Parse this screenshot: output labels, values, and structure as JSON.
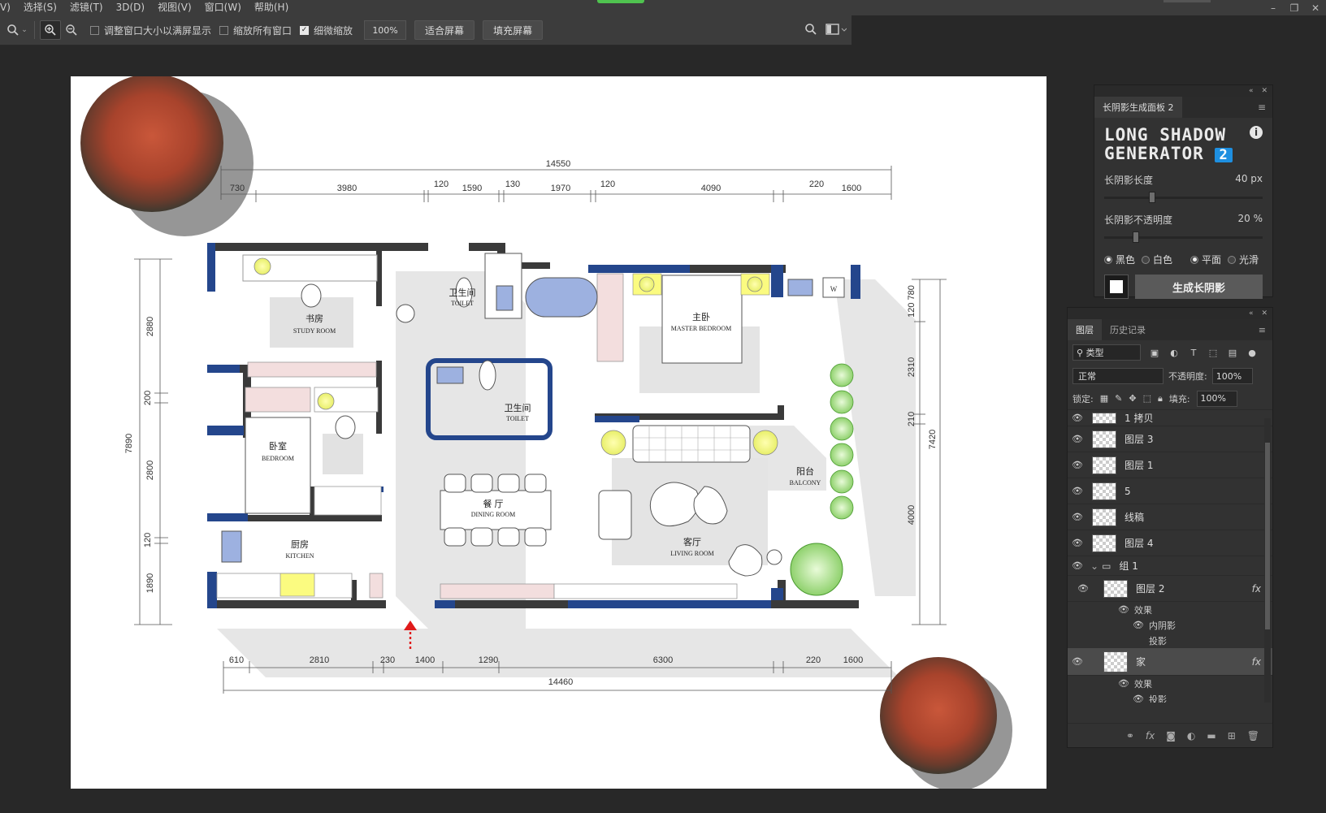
{
  "menu": [
    "V)",
    "选择(S)",
    "滤镜(T)",
    "3D(D)",
    "视图(V)",
    "窗口(W)",
    "帮助(H)"
  ],
  "options": {
    "resize_windows": "调整窗口大小以满屏显示",
    "zoom_all": "缩放所有窗口",
    "scrubby_zoom": "细微缩放",
    "zoom_pct": "100%",
    "fit_screen": "适合屏幕",
    "fill_screen": "填充屏幕"
  },
  "long_shadow": {
    "tab": "长阴影生成面板 2",
    "title_line1": "LONG SHADOW",
    "title_line2": "GENERATOR",
    "version": "2",
    "info": "i",
    "length_label": "长阴影长度",
    "length_value": "40 px",
    "length_level": 0.3,
    "opacity_label": "长阴影不透明度",
    "opacity_value": "20 %",
    "opacity_level": 0.2,
    "black": "黑色",
    "white": "白色",
    "flat": "平面",
    "smooth": "光滑",
    "generate": "生成长阴影"
  },
  "layers_panel": {
    "tab_layers": "图层",
    "tab_history": "历史记录",
    "filter_kind": "类型",
    "blend_mode": "正常",
    "opacity_label": "不透明度:",
    "opacity": "100%",
    "lock_label": "锁定:",
    "fill_label": "填充:",
    "fill": "100%",
    "layers": [
      "1 拷贝",
      "图层 3",
      "图层 1",
      "5",
      "线稿",
      "图层 4",
      "组 1",
      "图层 2",
      "效果",
      "内阴影",
      "投影",
      "家",
      "效果",
      "投影"
    ],
    "fx": "fx"
  },
  "plan": {
    "top_total": "14550",
    "top_dims": [
      "730",
      "3980",
      "120",
      "1590",
      "130",
      "1970",
      "120",
      "4090",
      "220",
      "1600"
    ],
    "bottom_dims": [
      "610",
      "2810",
      "230",
      "1400",
      "1290",
      "6300",
      "220",
      "1600"
    ],
    "bottom_total": "14460",
    "left_total": "7890",
    "left_dims": [
      "2880",
      "200",
      "2800",
      "120",
      "1890"
    ],
    "right_total": "7420",
    "right_dims": [
      "120 780",
      "2310",
      "210",
      "4000"
    ],
    "rooms": [
      {
        "cn": "书房",
        "en": "STUDY ROOM"
      },
      {
        "cn": "卫生间",
        "en": "TOILET"
      },
      {
        "cn": "主卧",
        "en": "MASTER BEDROOM"
      },
      {
        "cn": "卫生间",
        "en": "TOILET"
      },
      {
        "cn": "卧室",
        "en": "BEDROOM"
      },
      {
        "cn": "餐 厅",
        "en": "DINING ROOM"
      },
      {
        "cn": "阳台",
        "en": "BALCONY"
      },
      {
        "cn": "客厅",
        "en": "LIVING ROOM"
      },
      {
        "cn": "厨房",
        "en": "KITCHEN"
      }
    ],
    "washer": "W"
  }
}
